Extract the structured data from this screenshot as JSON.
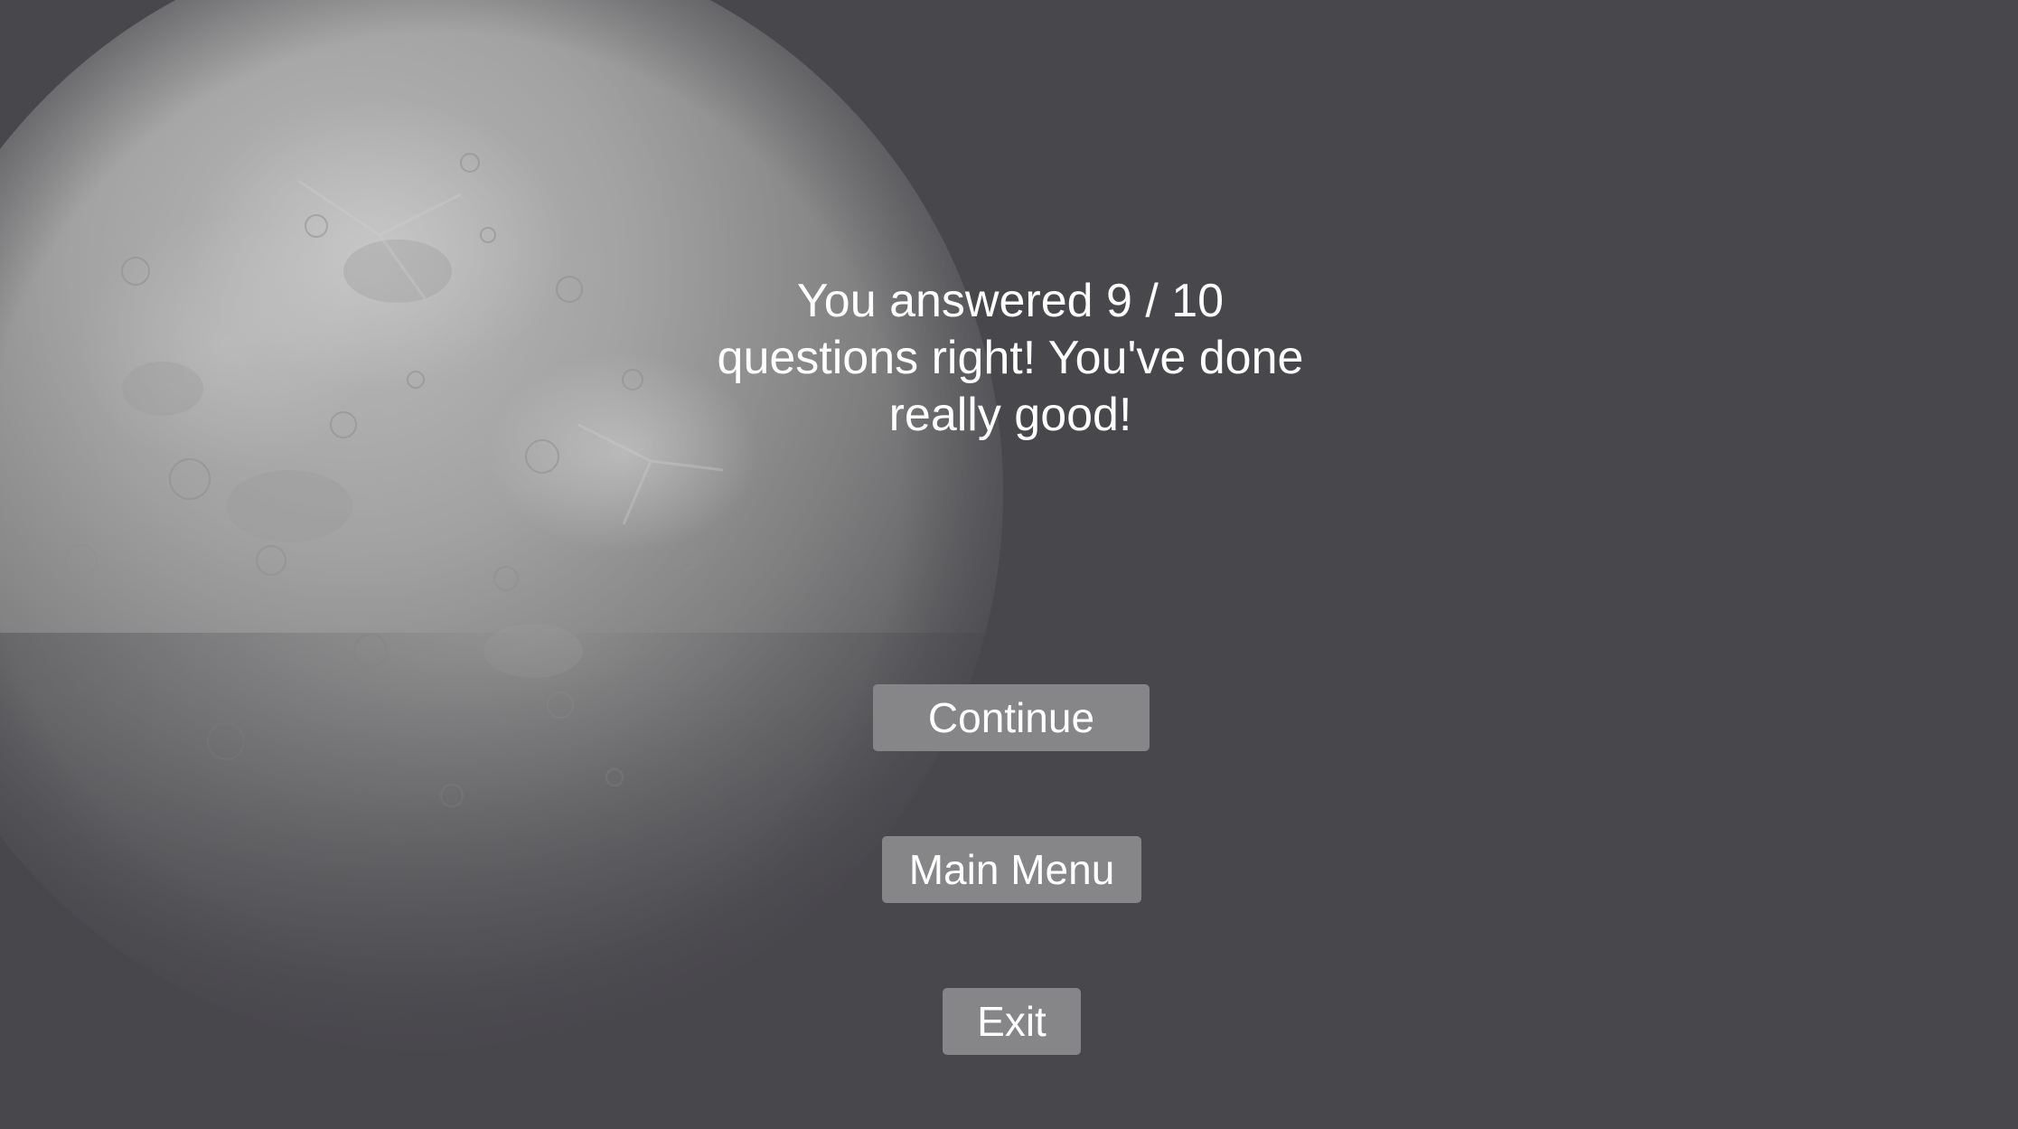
{
  "result": {
    "message": "You answered 9 / 10 questions right! You've done really good!"
  },
  "menu": {
    "continue_label": "Continue",
    "main_menu_label": "Main Menu",
    "exit_label": "Exit"
  },
  "colors": {
    "background": "#48474c",
    "button": "#868689",
    "text": "#ffffff"
  }
}
